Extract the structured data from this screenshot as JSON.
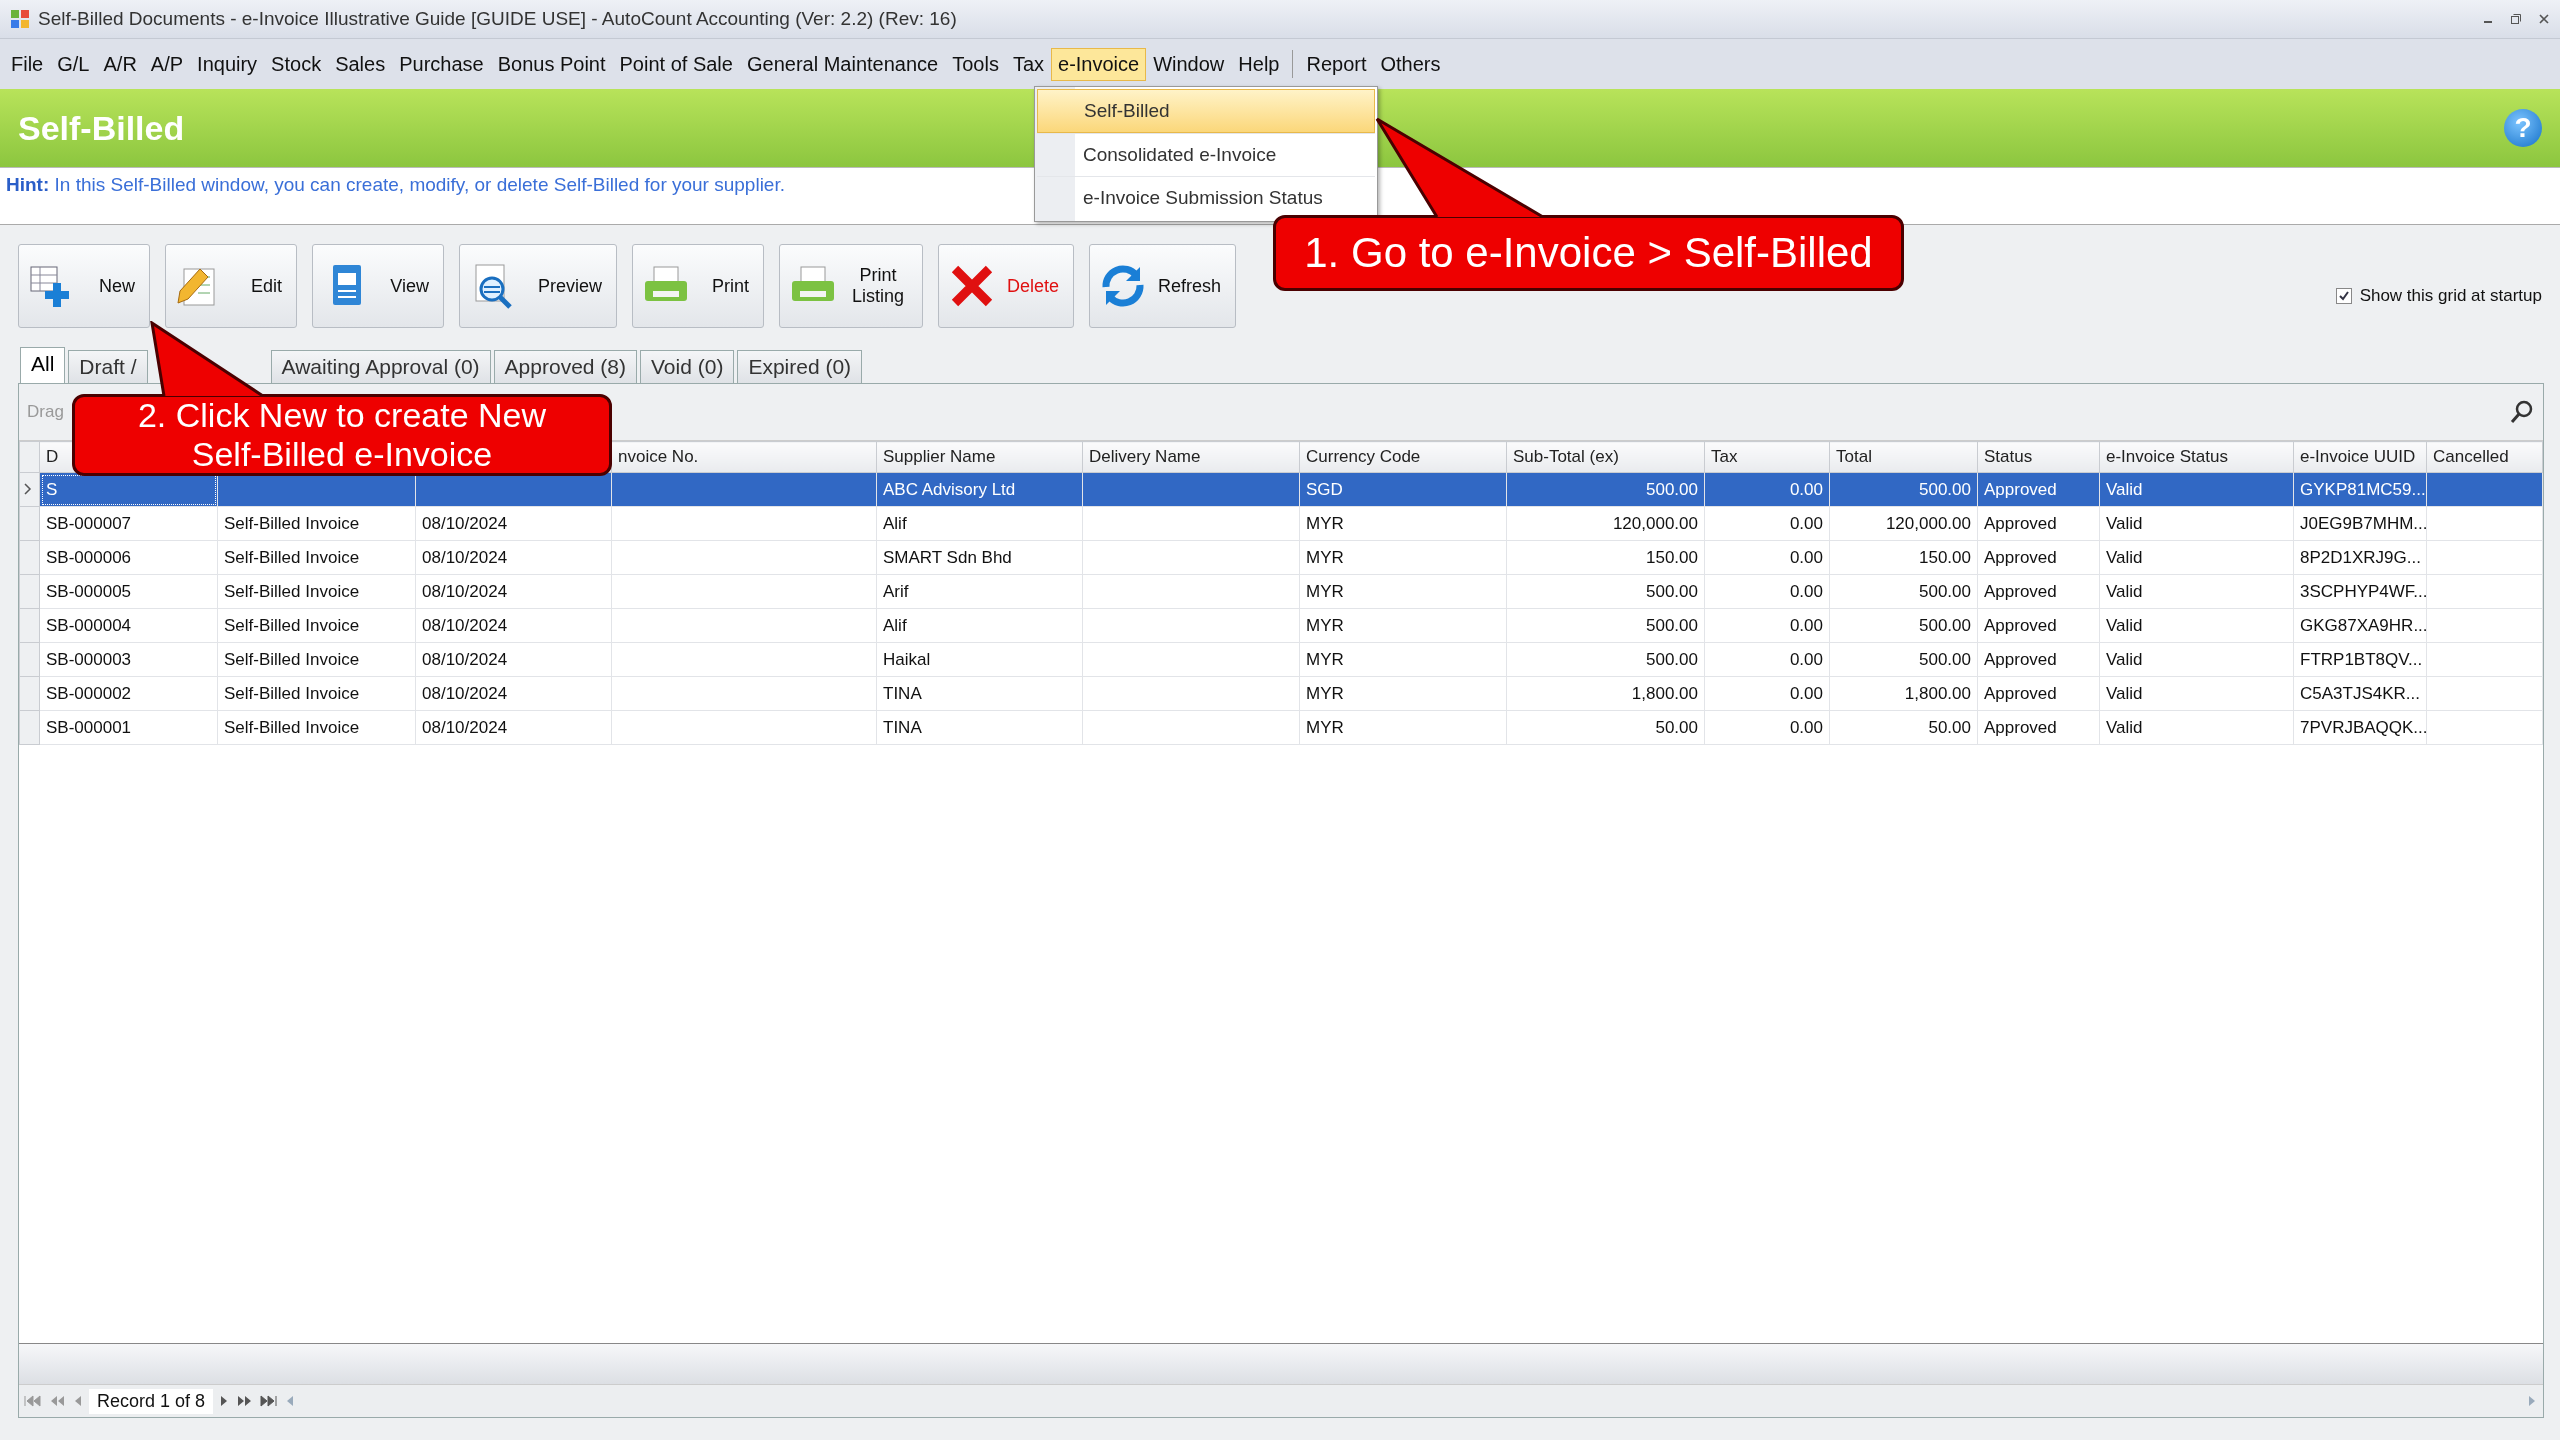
{
  "window": {
    "title": "Self-Billed Documents - e-Invoice Illustrative Guide [GUIDE USE] - AutoCount Accounting (Ver: 2.2) (Rev: 16)"
  },
  "menu": [
    {
      "label": "File",
      "selected": false
    },
    {
      "label": "G/L",
      "selected": false
    },
    {
      "label": "A/R",
      "selected": false
    },
    {
      "label": "A/P",
      "selected": false
    },
    {
      "label": "Inquiry",
      "selected": false
    },
    {
      "label": "Stock",
      "selected": false
    },
    {
      "label": "Sales",
      "selected": false
    },
    {
      "label": "Purchase",
      "selected": false
    },
    {
      "label": "Bonus Point",
      "selected": false
    },
    {
      "label": "Point of Sale",
      "selected": false
    },
    {
      "label": "General Maintenance",
      "selected": false
    },
    {
      "label": "Tools",
      "selected": false
    },
    {
      "label": "Tax",
      "selected": false
    },
    {
      "label": "e-Invoice",
      "selected": true
    },
    {
      "label": "Window",
      "selected": false
    },
    {
      "label": "Help",
      "selected": false
    }
  ],
  "menu_extra": [
    {
      "label": "Report",
      "selected": false
    },
    {
      "label": "Others",
      "selected": false
    }
  ],
  "dropdown": [
    {
      "label": "Self-Billed",
      "selected": true
    },
    {
      "label": "Consolidated e-Invoice",
      "selected": false
    },
    {
      "label": "e-Invoice Submission Status",
      "selected": false
    }
  ],
  "header": {
    "title": "Self-Billed",
    "help": "?"
  },
  "hint": {
    "label": "Hint:",
    "text": "In this Self-Billed window, you can create, modify, or delete Self-Billed for your supplier."
  },
  "toolbar": [
    {
      "label": "New",
      "kind": "new"
    },
    {
      "label": "Edit",
      "kind": "edit"
    },
    {
      "label": "View",
      "kind": "view"
    },
    {
      "label": "Preview",
      "kind": "preview"
    },
    {
      "label": "Print",
      "kind": "print"
    },
    {
      "label": "Print Listing",
      "kind": "listing"
    },
    {
      "label": "Delete",
      "kind": "delete"
    },
    {
      "label": "Refresh",
      "kind": "refresh"
    }
  ],
  "show_grid": {
    "label": "Show this grid at startup",
    "checked": true
  },
  "tabs": [
    {
      "label": "All",
      "selected": true
    },
    {
      "label": "Draft /",
      "selected": false
    },
    {
      "label": "Awaiting Approval (0)",
      "selected": false
    },
    {
      "label": "Approved (8)",
      "selected": false
    },
    {
      "label": "Void (0)",
      "selected": false
    },
    {
      "label": "Expired (0)",
      "selected": false
    }
  ],
  "group_panel": {
    "hint": "Drag"
  },
  "table": {
    "columns": [
      {
        "label": "D"
      },
      {},
      {},
      {
        "label": "nvoice No."
      },
      {
        "label": "Supplier Name"
      },
      {
        "label": "Delivery Name"
      },
      {
        "label": "Currency Code"
      },
      {
        "label": "Sub-Total (ex)"
      },
      {
        "label": "Tax"
      },
      {
        "label": "Total"
      },
      {
        "label": "Status"
      },
      {
        "label": "e-Invoice Status"
      },
      {
        "label": "e-Invoice UUID"
      },
      {
        "label": "Cancelled"
      }
    ],
    "rows": [
      {
        "selected": true,
        "cells": [
          "S",
          null,
          null,
          null,
          "ABC Advisory Ltd",
          null,
          "SGD",
          "500.00",
          "0.00",
          "500.00",
          "Approved",
          "Valid",
          "GYKP81MC59...",
          null
        ]
      },
      {
        "selected": false,
        "cells": [
          "SB-000007",
          "Self-Billed Invoice",
          "08/10/2024",
          null,
          "Alif",
          null,
          "MYR",
          "120,000.00",
          "0.00",
          "120,000.00",
          "Approved",
          "Valid",
          "J0EG9B7MHM...",
          null
        ]
      },
      {
        "selected": false,
        "cells": [
          "SB-000006",
          "Self-Billed Invoice",
          "08/10/2024",
          null,
          "SMART Sdn Bhd",
          null,
          "MYR",
          "150.00",
          "0.00",
          "150.00",
          "Approved",
          "Valid",
          "8P2D1XRJ9G...",
          null
        ]
      },
      {
        "selected": false,
        "cells": [
          "SB-000005",
          "Self-Billed Invoice",
          "08/10/2024",
          null,
          "Arif",
          null,
          "MYR",
          "500.00",
          "0.00",
          "500.00",
          "Approved",
          "Valid",
          "3SCPHYP4WF...",
          null
        ]
      },
      {
        "selected": false,
        "cells": [
          "SB-000004",
          "Self-Billed Invoice",
          "08/10/2024",
          null,
          "Alif",
          null,
          "MYR",
          "500.00",
          "0.00",
          "500.00",
          "Approved",
          "Valid",
          "GKG87XA9HR...",
          null
        ]
      },
      {
        "selected": false,
        "cells": [
          "SB-000003",
          "Self-Billed Invoice",
          "08/10/2024",
          null,
          "Haikal",
          null,
          "MYR",
          "500.00",
          "0.00",
          "500.00",
          "Approved",
          "Valid",
          "FTRP1BT8QV...",
          null
        ]
      },
      {
        "selected": false,
        "cells": [
          "SB-000002",
          "Self-Billed Invoice",
          "08/10/2024",
          null,
          "TINA",
          null,
          "MYR",
          "1,800.00",
          "0.00",
          "1,800.00",
          "Approved",
          "Valid",
          "C5A3TJS4KR...",
          null
        ]
      },
      {
        "selected": false,
        "cells": [
          "SB-000001",
          "Self-Billed Invoice",
          "08/10/2024",
          null,
          "TINA",
          null,
          "MYR",
          "50.00",
          "0.00",
          "50.00",
          "Approved",
          "Valid",
          "7PVRJBAQQK...",
          null
        ]
      }
    ]
  },
  "pager": {
    "text": "Record 1 of 8"
  },
  "callouts": [
    {
      "text": "1. Go to e-Invoice > Self-Billed"
    },
    {
      "text": "2. Click New to create New Self-Billed e-Invoice"
    }
  ]
}
